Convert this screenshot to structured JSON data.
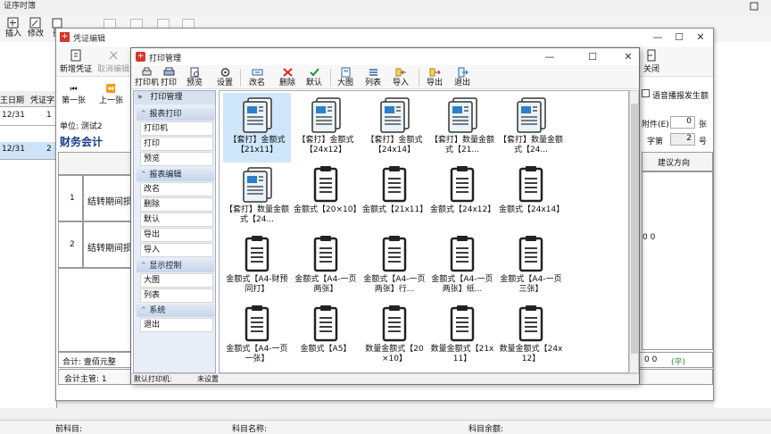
{
  "app": {
    "title": "证序时簿",
    "toolbar": [
      {
        "label": "插入",
        "icon": "insert-icon"
      },
      {
        "label": "修改",
        "icon": "edit-icon"
      },
      {
        "label": "删",
        "icon": "delete-icon"
      }
    ],
    "left_grid": {
      "headers": [
        "王日期",
        "凭证字"
      ],
      "rows": [
        {
          "date": "12/31",
          "num": "1"
        },
        {
          "date": "12/31",
          "num": "2"
        }
      ]
    },
    "bottom": {
      "left": "前科目:",
      "mid": "科目名称:",
      "right": "科目余额:"
    }
  },
  "voucher": {
    "title": "凭证编辑",
    "toolbar": [
      {
        "label": "新增凭证",
        "icon": "new-voucher-icon"
      },
      {
        "label": "取消编辑",
        "icon": "cancel-edit-icon"
      }
    ],
    "close_label": "关闭",
    "nav": [
      {
        "label": "第一张",
        "icon": "first-page-icon"
      },
      {
        "label": "上一张",
        "icon": "prev-page-icon"
      }
    ],
    "unit": "单位: 测试2",
    "heading": "财务会计",
    "rows": [
      {
        "no": "1",
        "summary": "结转期间损"
      },
      {
        "no": "2",
        "summary": "结转期间损"
      }
    ],
    "checkbox_label": "语音播报发生额",
    "attach_label": "附件(E)",
    "attach_value": "0",
    "attach_unit": "张",
    "word_label": "字第",
    "word_value": "2",
    "word_unit": "号",
    "suggest_col": "建议方向",
    "row_tail": "0 0",
    "sum_label": "合计: 壹佰元整",
    "sum_tail_a": "0 0",
    "sum_tail_b": "(平)",
    "footer_left": "会计主管: 1"
  },
  "print_manager": {
    "title": "打印管理",
    "toolbar": [
      {
        "label": "打印机",
        "icon": "printer-icon"
      },
      {
        "label": "打印",
        "icon": "print-icon"
      },
      {
        "label": "预览",
        "icon": "preview-icon"
      },
      {
        "label": "设置",
        "icon": "settings-icon"
      },
      {
        "label": "改名",
        "icon": "rename-icon"
      },
      {
        "label": "删除",
        "icon": "delete-icon"
      },
      {
        "label": "默认",
        "icon": "default-check-icon"
      },
      {
        "label": "大图",
        "icon": "large-icons-icon"
      },
      {
        "label": "列表",
        "icon": "list-view-icon"
      },
      {
        "label": "导入",
        "icon": "import-icon"
      },
      {
        "label": "导出",
        "icon": "export-icon"
      },
      {
        "label": "退出",
        "icon": "exit-icon"
      }
    ],
    "sidebar_title": "打印管理",
    "groups": [
      {
        "name": "报表打印",
        "items": [
          "打印机",
          "打印",
          "预览"
        ]
      },
      {
        "name": "报表编辑",
        "items": [
          "改名",
          "删除",
          "默认",
          "导出",
          "导入"
        ]
      },
      {
        "name": "显示控制",
        "items": [
          "大图",
          "列表"
        ]
      },
      {
        "name": "系统",
        "items": [
          "退出"
        ]
      }
    ],
    "templates": [
      {
        "label": "【套打】金额式【21x11】",
        "type": "doc",
        "selected": true
      },
      {
        "label": "【套打】金额式【24x12】",
        "type": "doc"
      },
      {
        "label": "【套打】金额式【24x14】",
        "type": "doc"
      },
      {
        "label": "【套打】数量金额式【21...",
        "type": "doc"
      },
      {
        "label": "【套打】数量金额式【24...",
        "type": "doc"
      },
      {
        "label": "【套打】数量金额式【24...",
        "type": "doc"
      },
      {
        "label": "金额式【20×10】",
        "type": "clip"
      },
      {
        "label": "金额式【21x11】",
        "type": "clip"
      },
      {
        "label": "金额式【24x12】",
        "type": "clip"
      },
      {
        "label": "金额式【24x14】",
        "type": "clip"
      },
      {
        "label": "金额式【A4-财预同打】",
        "type": "clip"
      },
      {
        "label": "金额式【A4-一页两张】",
        "type": "clip"
      },
      {
        "label": "金额式【A4-一页两张】行...",
        "type": "clip"
      },
      {
        "label": "金额式【A4-一页两张】纸...",
        "type": "clip"
      },
      {
        "label": "金额式【A4-一页三张】",
        "type": "clip"
      },
      {
        "label": "金额式【A4-一页一张】",
        "type": "clip"
      },
      {
        "label": "金额式【A5】",
        "type": "clip"
      },
      {
        "label": "数量金额式【20×10】",
        "type": "clip"
      },
      {
        "label": "数量金额式【21x11】",
        "type": "clip"
      },
      {
        "label": "数量金额式【24x12】",
        "type": "clip"
      }
    ],
    "status_left": "默认打印机:",
    "status_right": "未设置"
  }
}
